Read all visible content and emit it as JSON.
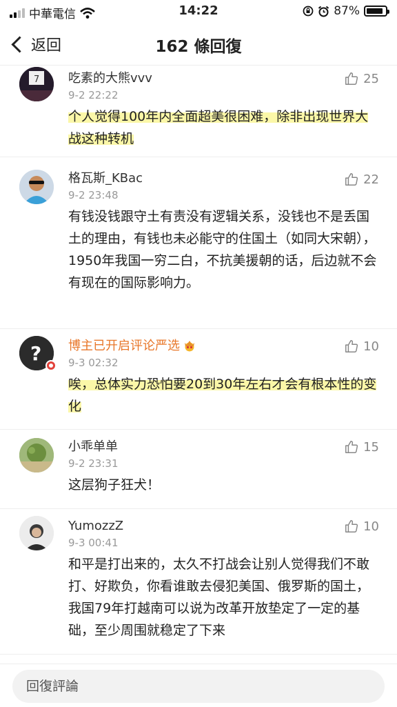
{
  "status_bar": {
    "carrier": "中華電信",
    "time": "14:22",
    "battery": "87%",
    "battery_level": 0.87,
    "icons": [
      "signal-icon",
      "wifi-icon",
      "lock-rotation-icon",
      "alarm-icon",
      "battery-icon"
    ]
  },
  "nav": {
    "back_label": "返回",
    "title": "162 條回復"
  },
  "comments": [
    {
      "user": "吃素的大熊vvv",
      "time": "9-2 22:22",
      "text": "个人觉得100年内全面超美很困难，除非出现世界大战这种转机",
      "likes": "25",
      "highlighted": true
    },
    {
      "user": "格瓦斯_KBac",
      "time": "9-2 23:48",
      "text": "有钱没钱跟守土有责没有逻辑关系，没钱也不是丢国土的理由，有钱也未必能守的住国土（如同大宋朝），1950年我国一穷二白，不抗美援朝的话，后边就不会有现在的国际影响力。",
      "likes": "22",
      "highlighted": false
    },
    {
      "user": "博主已开启评论严选",
      "time": "9-3 02:32",
      "text": "唉，总体实力恐怕要20到30年左右才会有根本性的变化",
      "likes": "10",
      "highlighted": true
    },
    {
      "user": "小乖单单",
      "time": "9-2 23:31",
      "text": "这层狗子狂犬！",
      "likes": "15",
      "highlighted": false
    },
    {
      "user": "YumozzZ",
      "time": "9-3 00:41",
      "text": "和平是打出来的，太久不打战会让别人觉得我们不敢打、好欺负，你看谁敢去侵犯美国、俄罗斯的国土，我国79年打越南可以说为改革开放垫定了一定的基础，至少周围就稳定了下来",
      "likes": "10",
      "highlighted": false
    }
  ],
  "reply_input": {
    "placeholder": "回復評論"
  },
  "colors": {
    "highlight": "#fbf7a8",
    "author_name": "#e8772a",
    "badge": "#e2413a"
  }
}
